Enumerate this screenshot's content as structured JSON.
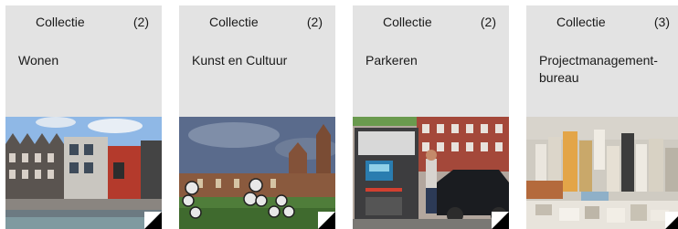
{
  "cards": [
    {
      "label": "Collectie",
      "count": "(2)",
      "title": "Wonen",
      "image_icon": "housing-photo"
    },
    {
      "label": "Collectie",
      "count": "(2)",
      "title": "Kunst en Cultuur",
      "image_icon": "museum-photo"
    },
    {
      "label": "Collectie",
      "count": "(2)",
      "title": "Parkeren",
      "image_icon": "parking-photo"
    },
    {
      "label": "Collectie",
      "count": "(3)",
      "title": "Projectmanagement-bureau",
      "image_icon": "city-model-photo"
    }
  ]
}
